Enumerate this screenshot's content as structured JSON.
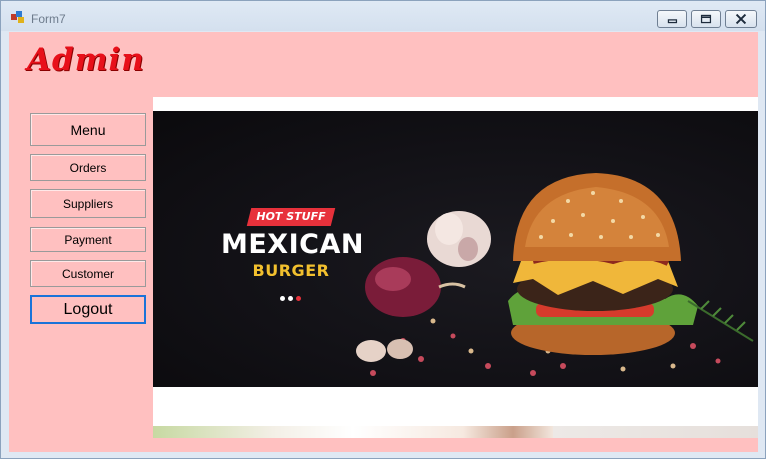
{
  "window": {
    "title": "Form7"
  },
  "header": {
    "title": "Admin"
  },
  "sidebar": {
    "items": [
      {
        "label": "Menu"
      },
      {
        "label": "Orders"
      },
      {
        "label": "Suppliers"
      },
      {
        "label": "Payment"
      },
      {
        "label": "Customer"
      },
      {
        "label": "Logout"
      }
    ]
  },
  "banner": {
    "tag": "HOT STUFF",
    "headline": "MEXICAN",
    "subhead": "BURGER",
    "slide_dots": 3,
    "active_dot": 3
  },
  "colors": {
    "form_background": "#ffc0c0",
    "admin_title": "#e8101a",
    "tag_background": "#e7313b",
    "subhead": "#f2c02e",
    "focus_border": "#1a73d9"
  },
  "icons": {
    "app": "form-app-icon",
    "minimize": "minimize-icon",
    "maximize": "maximize-icon",
    "close": "close-icon"
  }
}
